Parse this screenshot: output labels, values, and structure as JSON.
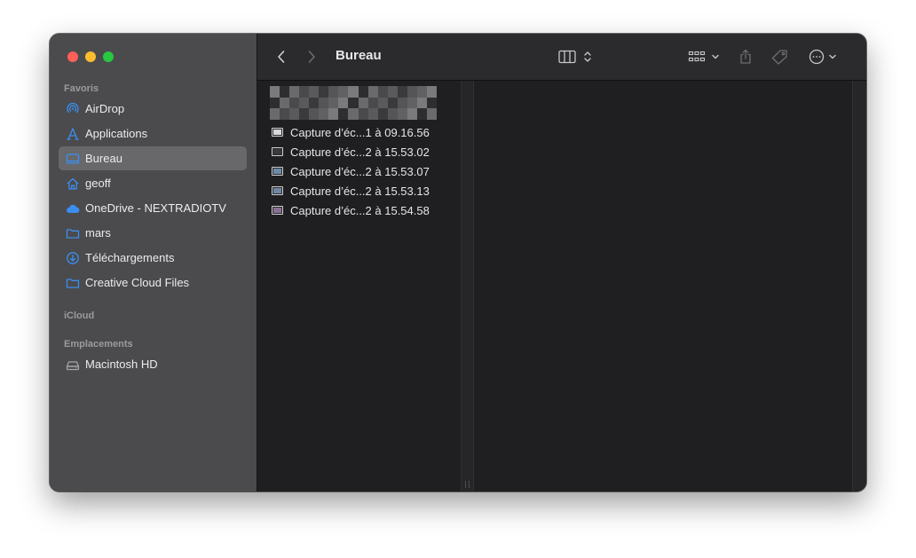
{
  "sidebar": {
    "sections": [
      {
        "title": "Favoris"
      },
      {
        "title": "iCloud"
      },
      {
        "title": "Emplacements"
      }
    ],
    "favorites": [
      {
        "label": "AirDrop",
        "icon": "airdrop-icon"
      },
      {
        "label": "Applications",
        "icon": "applications-icon"
      },
      {
        "label": "Bureau",
        "icon": "desktop-icon",
        "selected": true
      },
      {
        "label": "geoff",
        "icon": "home-icon"
      },
      {
        "label": "OneDrive - NEXTRADIOTV",
        "icon": "cloud-icon"
      },
      {
        "label": "mars",
        "icon": "folder-icon"
      },
      {
        "label": "Téléchargements",
        "icon": "downloads-icon"
      },
      {
        "label": "Creative Cloud Files",
        "icon": "folder-icon"
      }
    ],
    "locations": [
      {
        "label": "Macintosh HD",
        "icon": "disk-icon"
      }
    ]
  },
  "toolbar": {
    "title": "Bureau"
  },
  "files": [
    {
      "name": "Capture d’éc...1 à 09.16.56"
    },
    {
      "name": "Capture d’éc...2 à 15.53.02"
    },
    {
      "name": "Capture d’éc...2 à 15.53.07"
    },
    {
      "name": "Capture d’éc...2 à 15.53.13"
    },
    {
      "name": "Capture d’éc...2 à 15.54.58"
    }
  ],
  "colors": {
    "accent": "#3b8ef0",
    "close": "#fe5f57",
    "minimize": "#febc2e",
    "zoom": "#28c840",
    "selection": "#68686a"
  }
}
